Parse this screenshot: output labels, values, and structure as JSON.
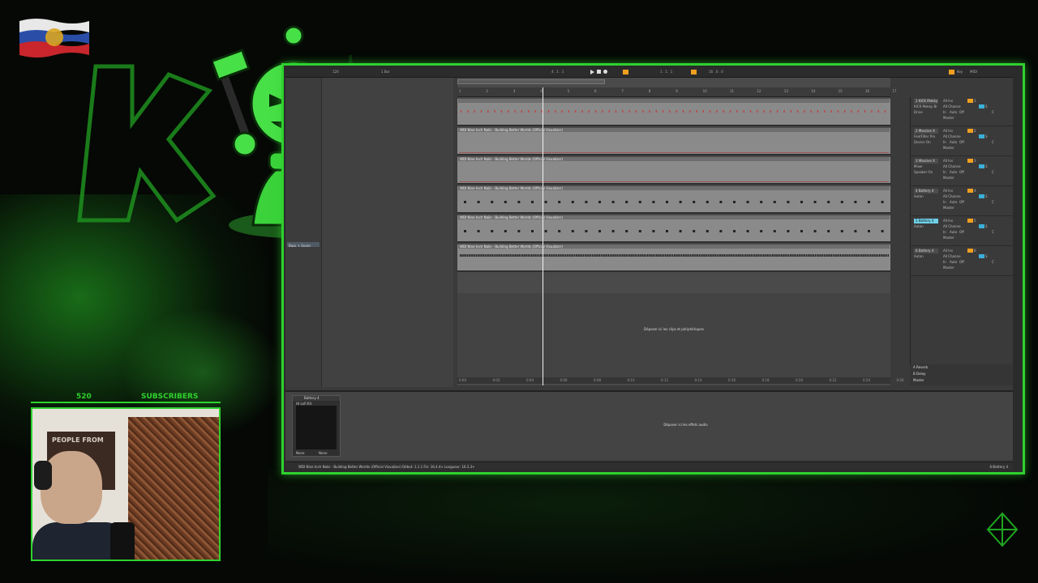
{
  "overlay": {
    "subscriber_count": "520",
    "subscribers_label": "SUBSCRIBERS",
    "accent_color": "#2fd12f"
  },
  "daw": {
    "topbar": {
      "tempo_display": "120",
      "loop_value": "1 Bar",
      "position": "4 . 1 . 1",
      "position2": "1 . 1 . 1",
      "loop_length": "16 . 0 . 0",
      "key_label": "Key",
      "midi_label": "MIDI"
    },
    "ruler": [
      "1",
      "2",
      "3",
      "4",
      "5",
      "6",
      "7",
      "8",
      "9",
      "10",
      "11",
      "12",
      "13",
      "14",
      "15",
      "16",
      "17"
    ],
    "time_ruler": [
      "0:00",
      "0:02",
      "0:04",
      "0:06",
      "0:08",
      "0:10",
      "0:12",
      "0:14",
      "0:16",
      "0:18",
      "0:20",
      "0:22",
      "0:24",
      "0:26"
    ],
    "browser": {
      "selected_item": "Bass + Snare"
    },
    "tracks": [
      {
        "clip_title": ""
      },
      {
        "clip_title": "WDI Nine Inch Nails - Building Better Worlds (Official Visualizer)"
      },
      {
        "clip_title": "WDI Nine Inch Nails - Building Better Worlds (Official Visualizer)"
      },
      {
        "clip_title": "WDI Nine Inch Nails - Building Better Worlds (Official Visualizer)"
      },
      {
        "clip_title": "WDI Nine Inch Nails - Building Better Worlds (Official Visualizer)"
      },
      {
        "clip_title": "WDI Nine Inch Nails - Building Better Worlds (Official Visualizer)"
      }
    ],
    "mixer": {
      "set_label": "Set",
      "channels": [
        {
          "name": "1 KICK Mekky",
          "sub1": "KICK Mekky Br",
          "sub2": "Drive",
          "input": "All Ins",
          "chan": "All Channe",
          "in": "In",
          "auto": "Auto",
          "off": "Off",
          "master": "Master",
          "num": "1",
          "s": "S",
          "c": "C"
        },
        {
          "name": "2 Massive X",
          "sub1": "FeatFilter Pro",
          "sub2": "Device On",
          "input": "All Ins",
          "chan": "All Channe",
          "in": "In",
          "auto": "Auto",
          "off": "Off",
          "master": "Master",
          "num": "2",
          "s": "S",
          "c": "C"
        },
        {
          "name": "3 Massive X",
          "sub1": "Mixer",
          "sub2": "Speaker On",
          "input": "All Ins",
          "chan": "All Channe",
          "in": "In",
          "auto": "Auto",
          "off": "Off",
          "master": "Master",
          "num": "3",
          "s": "S",
          "c": "C"
        },
        {
          "name": "4 Battery 4",
          "sub1": "Auton",
          "sub2": "",
          "input": "All Ins",
          "chan": "All Channe",
          "in": "In",
          "auto": "Auto",
          "off": "Off",
          "master": "Master",
          "num": "4",
          "s": "S",
          "c": "C"
        },
        {
          "name": "5 Battery 4",
          "sub1": "Auton",
          "sub2": "",
          "input": "All Ins",
          "chan": "All Channe",
          "in": "In",
          "auto": "Auto",
          "off": "Off",
          "master": "Master",
          "num": "5",
          "s": "S",
          "c": "C"
        },
        {
          "name": "6 Battery 4",
          "sub1": "Auton",
          "sub2": "",
          "input": "All Ins",
          "chan": "All Channe",
          "in": "In",
          "auto": "Auto",
          "off": "Off",
          "master": "Master",
          "num": "6",
          "s": "S",
          "c": "C"
        }
      ],
      "returns": [
        "A Reverb",
        "B Delay",
        "Master"
      ]
    },
    "drop_clips_msg": "Déposer ici les clips et périphériques",
    "drop_fx_msg": "Déposer ici les effets audio",
    "device": {
      "name": "Battery 4",
      "preset": "HI Lofi Kit",
      "foot_left": "None",
      "foot_right": "None"
    },
    "status": {
      "text": "WDI Nine Inch Nails - Building Better Worlds (Official Visualizer)  Début: 1.1.1  Fin: 16.4.4+  Longueur: 16.3.3+",
      "track": "6-Battery 4"
    }
  },
  "webcam": {
    "poster_text": "PEOPLE FROM"
  }
}
